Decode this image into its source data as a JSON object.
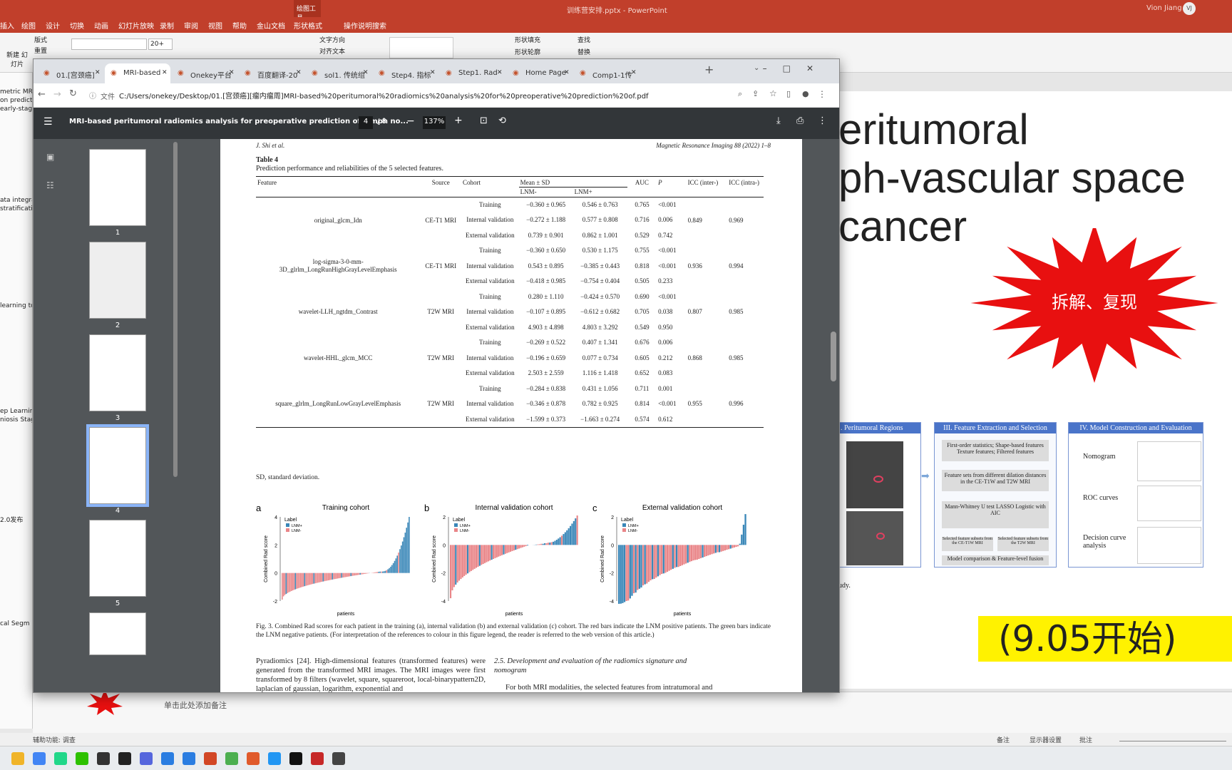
{
  "ppt": {
    "title": "训练营安排.pptx - PowerPoint",
    "context_tab": "绘图工具",
    "user": "Vion Jiang",
    "user_initials": "VJ",
    "tabs": [
      "插入",
      "绘图",
      "设计",
      "切换",
      "动画",
      "幻灯片放映",
      "录制",
      "审阅",
      "视图",
      "帮助",
      "金山文档",
      "形状格式"
    ],
    "tell_me": "操作说明搜索",
    "ribbon": {
      "layout": "版式",
      "reset": "重置",
      "new_slide": "新建 幻灯片",
      "font_size": "20+",
      "text_dir": "文字方向",
      "align_text": "对齐文本",
      "shape_fill": "形状填充",
      "shape_outline": "形状轮廓",
      "find": "查找",
      "replace": "替换"
    },
    "slide": {
      "title_lines": [
        "eritumoral",
        "ph-vascular space",
        " cancer"
      ],
      "burst_text": "拆解、复现",
      "time_text": "(9.05开始)",
      "note_word": "udy.",
      "fig": {
        "col1": ". Peritumoral Regions",
        "col2": "III. Feature Extraction and Selection",
        "col3": "IV. Model Construction and Evaluation",
        "box1": "First-order statistics; Shape-based features Texture features; Filtered features",
        "box2": "Feature sets from different dilation distances in the CE-T1W and T2W MRI",
        "box3": "Mann-Whitney U test LASSO Logistic with AIC",
        "box4a": "Selected feature subsets from the CE-T1W MRI",
        "box4b": "Selected feature subsets from the T2W MRI",
        "box5": "Model comparison & Feature-level fusion",
        "nomogram": "Nomogram",
        "roc": "ROC curves",
        "dca": "Decision curve analysis"
      }
    },
    "notes": "单击此处添加备注",
    "status": {
      "accessibility": "辅助功能: 调查",
      "notes": "备注",
      "display": "显示器设置",
      "comments": "批注"
    },
    "left_snippets": [
      "metric MR",
      "on predict",
      "early-stag",
      "ata integrati",
      "stratification",
      "learning to",
      "ep Learnin",
      "niosis Stag",
      "2.0发布",
      "cal Segm"
    ]
  },
  "chrome": {
    "tabs": [
      "01.[宫颈癌]",
      "MRI-based p",
      "Onekey平台",
      "百度翻译-20",
      "sol1. 传统组",
      "Step4. 指标",
      "Step1. Rad",
      "Home Page",
      "Comp1-1传"
    ],
    "address_label": "文件",
    "url": "C:/Users/onekey/Desktop/01.[宫颈癌][瘤内瘤周]MRI-based%20peritumoral%20radiomics%20analysis%20for%20preoperative%20prediction%20of.pdf"
  },
  "pdf": {
    "title": "MRI-based peritumoral radiomics analysis for preoperative prediction of lymph no...",
    "page": "4",
    "total": "/ 8",
    "zoom": "137%",
    "thumb_labels": [
      "1",
      "2",
      "3",
      "4",
      "5"
    ],
    "header_left": "J. Shi et al.",
    "header_right": "Magnetic Resonance Imaging 88 (2022) 1–8",
    "table_title": "Table 4",
    "table_caption": "Prediction performance and reliabilities of the 5 selected features.",
    "table_head": [
      "Feature",
      "Source",
      "Cohort",
      "Mean ± SD",
      "AUC",
      "P",
      "ICC (inter-)",
      "ICC (intra-)"
    ],
    "table_sub": [
      "LNM-",
      "LNM+"
    ],
    "rows": [
      {
        "feature": "original_glcm_Idn",
        "source": "CE-T1 MRI",
        "icc1": "0.849",
        "icc2": "0.969",
        "cohorts": [
          [
            "Training",
            "−0.360 ± 0.965",
            "0.546 ± 0.763",
            "0.765",
            "<0.001"
          ],
          [
            "Internal validation",
            "−0.272 ± 1.188",
            "0.577 ± 0.808",
            "0.716",
            "0.006"
          ],
          [
            "External validation",
            "0.739 ± 0.901",
            "0.862 ± 1.001",
            "0.529",
            "0.742"
          ]
        ]
      },
      {
        "feature": "log-sigma-3-0-mm-3D_glrlm_LongRunHighGrayLevelEmphasis",
        "source": "CE-T1 MRI",
        "icc1": "0.936",
        "icc2": "0.994",
        "cohorts": [
          [
            "Training",
            "−0.360 ± 0.650",
            "0.530 ± 1.175",
            "0.755",
            "<0.001"
          ],
          [
            "Internal validation",
            "0.543 ± 0.895",
            "−0.385 ± 0.443",
            "0.818",
            "<0.001"
          ],
          [
            "External validation",
            "−0.418 ± 0.985",
            "−0.754 ± 0.404",
            "0.505",
            "0.233"
          ]
        ]
      },
      {
        "feature": "wavelet-LLH_ngtdm_Contrast",
        "source": "T2W MRI",
        "icc1": "0.807",
        "icc2": "0.985",
        "cohorts": [
          [
            "Training",
            "0.280 ± 1.110",
            "−0.424 ± 0.570",
            "0.690",
            "<0.001"
          ],
          [
            "Internal validation",
            "−0.107 ± 0.895",
            "−0.612 ± 0.682",
            "0.705",
            "0.038"
          ],
          [
            "External validation",
            "4.903 ± 4.898",
            "4.803 ± 3.292",
            "0.549",
            "0.950"
          ]
        ]
      },
      {
        "feature": "wavelet-HHL_glcm_MCC",
        "source": "T2W MRI",
        "icc1": "0.868",
        "icc2": "0.985",
        "cohorts": [
          [
            "Training",
            "−0.269 ± 0.522",
            "0.407 ± 1.341",
            "0.676",
            "0.006"
          ],
          [
            "Internal validation",
            "−0.196 ± 0.659",
            "0.077 ± 0.734",
            "0.605",
            "0.212"
          ],
          [
            "External validation",
            "2.503 ± 2.559",
            "1.116 ± 1.418",
            "0.652",
            "0.083"
          ]
        ]
      },
      {
        "feature": "square_glrlm_LongRunLowGrayLevelEmphasis",
        "source": "T2W MRI",
        "icc1": "0.955",
        "icc2": "0.996",
        "cohorts": [
          [
            "Training",
            "−0.284 ± 0.838",
            "0.431 ± 1.056",
            "0.711",
            "0.001"
          ],
          [
            "Internal validation",
            "−0.346 ± 0.878",
            "0.782 ± 0.925",
            "0.814",
            "<0.001"
          ],
          [
            "External validation",
            "−1.599 ± 0.373",
            "−1.663 ± 0.274",
            "0.574",
            "0.612"
          ]
        ]
      }
    ],
    "table_note": "SD, standard deviation.",
    "fig_caption": "Fig. 3. Combined Rad scores for each patient in the training (a), internal validation (b) and external validation (c) cohort. The red bars indicate the LNM positive patients. The green bars indicate the LNM negative patients. (For interpretation of the references to colour in this figure legend, the reader is referred to the web version of this article.)",
    "body_left": "Pyradiomics [24]. High-dimensional features (transformed features) were generated from the transformed MRI images. The MRI images were first transformed by 8 filters (wavelet, square, squareroot, local-binarypattern2D, laplacian of gaussian, logarithm, exponential and",
    "body_right_head": "2.5. Development and evaluation of the radiomics signature and nomogram",
    "body_right": "For both MRI modalities, the selected features from intratumoral and"
  },
  "chart_data": [
    {
      "type": "bar",
      "panel": "a",
      "title": "Training cohort",
      "xlabel": "patients",
      "ylabel": "Combined Rad score",
      "legend_title": "Label",
      "legend": [
        "LNM+",
        "LNM-"
      ],
      "ylim": [
        -2,
        4
      ],
      "yticks": [
        -2,
        0,
        2,
        4
      ],
      "n_neg": 75,
      "n_pos": 22,
      "neg_range": [
        -1.9,
        0.1
      ],
      "pos_range": [
        0.1,
        4.0
      ]
    },
    {
      "type": "bar",
      "panel": "b",
      "title": "Internal validation cohort",
      "xlabel": "patients",
      "ylabel": "Combined Rad score",
      "legend_title": "Label",
      "legend": [
        "LNM+",
        "LNM-"
      ],
      "ylim": [
        -4,
        2
      ],
      "yticks": [
        -4,
        -2,
        0,
        2
      ],
      "n_neg": 52,
      "n_pos": 23,
      "neg_range": [
        -3.8,
        0.2
      ],
      "pos_range": [
        0.0,
        2.1
      ]
    },
    {
      "type": "bar",
      "panel": "c",
      "title": "External validation cohort",
      "xlabel": "patients",
      "ylabel": "Combined Rad score",
      "legend_title": "Label",
      "legend": [
        "LNM+",
        "LNM-"
      ],
      "ylim": [
        -4,
        2
      ],
      "yticks": [
        -4,
        -2,
        0,
        2
      ],
      "n_neg": 50,
      "n_pos": 19,
      "neg_range": [
        -4.0,
        -0.1
      ],
      "pos_range": [
        -4.2,
        2.2
      ]
    }
  ],
  "colors": {
    "lnm_pos": "#3a87b8",
    "lnm_neg": "#e98588",
    "ppt_red": "#c13f2b",
    "burst": "#e81010",
    "highlight": "#fff200",
    "fig_header": "#4a74c9"
  },
  "taskbar_icons": [
    "folder-icon",
    "chrome-icon",
    "pycharm-icon",
    "wechat-icon",
    "app-icon",
    "app-icon",
    "app-icon",
    "app-icon",
    "app-icon",
    "powerpoint-icon",
    "app-icon",
    "app-icon",
    "app-icon",
    "terminal-icon",
    "app-icon",
    "app-icon"
  ]
}
